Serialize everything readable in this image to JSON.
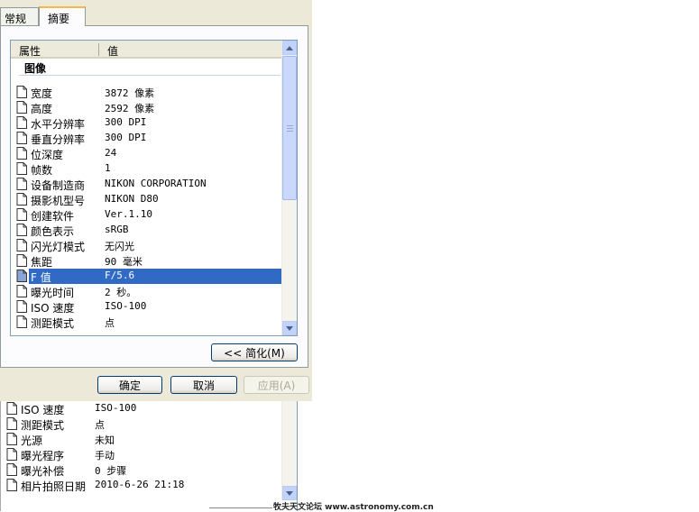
{
  "tabs": [
    "常规",
    "摘要"
  ],
  "list": {
    "col_property": "属性",
    "col_value": "值",
    "group": "图像",
    "rows": [
      {
        "name": "宽度",
        "value": "3872 像素"
      },
      {
        "name": "高度",
        "value": "2592 像素"
      },
      {
        "name": "水平分辨率",
        "value": "300 DPI"
      },
      {
        "name": "垂直分辨率",
        "value": "300 DPI"
      },
      {
        "name": "位深度",
        "value": "24"
      },
      {
        "name": "帧数",
        "value": "1"
      },
      {
        "name": "设备制造商",
        "value": "NIKON CORPORATION"
      },
      {
        "name": "摄影机型号",
        "value": "NIKON D80"
      },
      {
        "name": "创建软件",
        "value": "Ver.1.10"
      },
      {
        "name": "颜色表示",
        "value": "sRGB"
      },
      {
        "name": "闪光灯模式",
        "value": "无闪光"
      },
      {
        "name": "焦距",
        "value": "90 毫米"
      },
      {
        "name": "F 值",
        "value": "F/5.6",
        "selected": true
      },
      {
        "name": "曝光时间",
        "value": "2 秒。"
      },
      {
        "name": "ISO 速度",
        "value": "ISO-100"
      },
      {
        "name": "测距模式",
        "value": "点"
      }
    ]
  },
  "simplify_button": "<< 简化(M)",
  "ok_button": "确定",
  "cancel_button": "取消",
  "apply_button": "应用(A)",
  "lower_rows": [
    {
      "name": "ISO 速度",
      "value": "ISO-100"
    },
    {
      "name": "测距模式",
      "value": "点"
    },
    {
      "name": "光源",
      "value": "未知"
    },
    {
      "name": "曝光程序",
      "value": "手动"
    },
    {
      "name": "曝光补偿",
      "value": "0 步骤"
    },
    {
      "name": "相片拍照日期",
      "value": "2010-6-26 21:18"
    }
  ],
  "watermark": "牧夫天文论坛 www.astronomy.com.cn"
}
